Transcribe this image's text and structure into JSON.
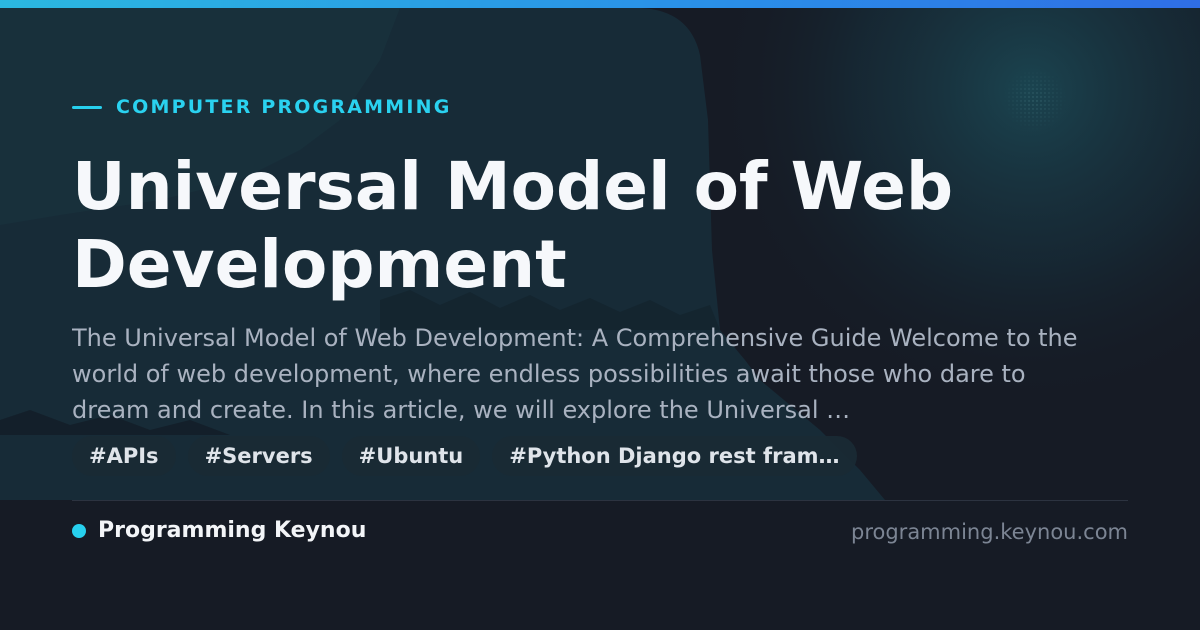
{
  "category": "COMPUTER PROGRAMMING",
  "title": "Universal Model of Web Development",
  "excerpt": "The Universal Model of Web Development: A Comprehensive Guide Welcome to the world of web development, where endless possibilities await those who dare to dream and create. In this article, we will explore the Universal …",
  "tags": [
    "#APIs",
    "#Servers",
    "#Ubuntu",
    "#Python Django rest fram…"
  ],
  "site_name": "Programming Keynou",
  "site_url": "programming.keynou.com",
  "colors": {
    "accent": "#27d0ee",
    "background": "#161b25",
    "title": "#f6f8fb",
    "excerpt": "#a9b2c0",
    "muted": "#7c8594"
  }
}
